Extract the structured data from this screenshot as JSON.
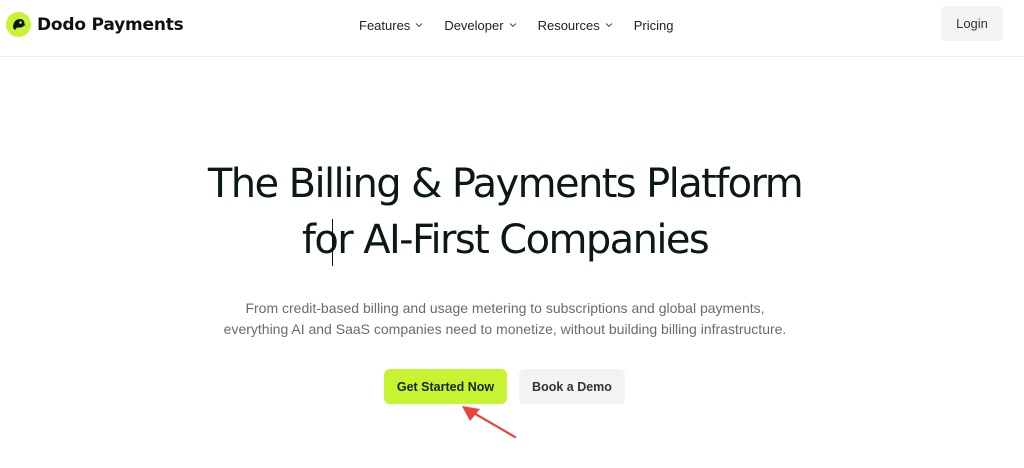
{
  "header": {
    "brand_name": "Dodo Payments",
    "brand_icon": "dodo-bird-logo-icon",
    "nav": [
      {
        "label": "Features",
        "has_dropdown": true,
        "icon": "chevron-down-icon"
      },
      {
        "label": "Developer",
        "has_dropdown": true,
        "icon": "chevron-down-icon"
      },
      {
        "label": "Resources",
        "has_dropdown": true,
        "icon": "chevron-down-icon"
      },
      {
        "label": "Pricing",
        "has_dropdown": false
      }
    ],
    "login_label": "Login"
  },
  "hero": {
    "title_line1": "The Billing & Payments Platform",
    "title_line2": "for AI-First Companies",
    "subtitle_line1": "From credit-based billing and usage metering to subscriptions and global payments,",
    "subtitle_line2": "everything AI and SaaS companies need to monetize, without building billing infrastructure.",
    "primary_cta": "Get Started Now",
    "secondary_cta": "Book a Demo"
  },
  "annotation": {
    "pointer_icon": "red-arrow-pointer-icon"
  },
  "colors": {
    "accent": "#c6f432",
    "heading": "#0b1a10",
    "body_text": "#6b6b6b",
    "secondary_button_bg": "#f3f3f3",
    "annotation_arrow": "#e8453c"
  }
}
